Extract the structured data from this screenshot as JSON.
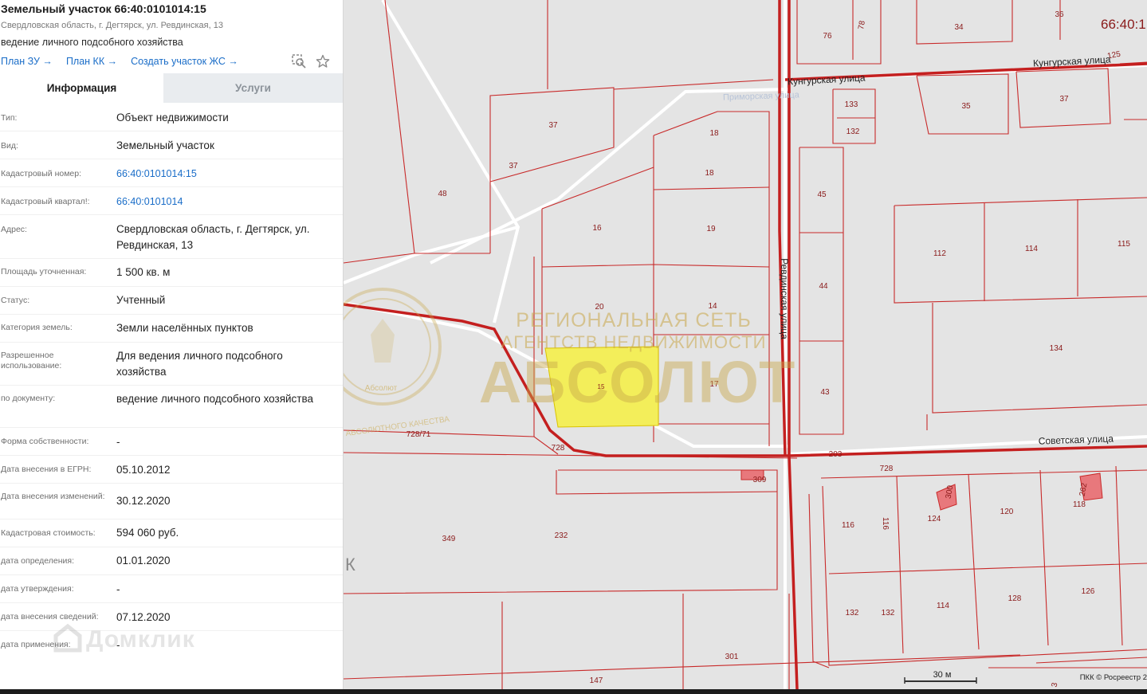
{
  "panel": {
    "title": "Земельный участок 66:40:0101014:15",
    "address_line": "Свердловская область, г. Дегтярск, ул. Ревдинская, 13",
    "usage_line": "ведение личного подсобного хозяйства",
    "links": [
      "План ЗУ →",
      "План КК →",
      "Создать участок ЖС →"
    ],
    "icons": [
      "search-map-icon",
      "star-icon"
    ],
    "tabs": {
      "info": "Информация",
      "services": "Услуги"
    },
    "rows": [
      {
        "label": "Тип:",
        "value": "Объект недвижимости"
      },
      {
        "label": "Вид:",
        "value": "Земельный участок"
      },
      {
        "label": "Кадастровый номер:",
        "value": "66:40:0101014:15"
      },
      {
        "label": "Кадастровый квартал!:",
        "value": "66:40:0101014"
      },
      {
        "label": "Адрес:",
        "value": "Свердловская область, г. Дегтярск, ул. Ревдинская, 13"
      },
      {
        "label": "Площадь уточненная:",
        "value": "1 500 кв. м"
      },
      {
        "label": "Статус:",
        "value": "Учтенный"
      },
      {
        "label": "Категория земель:",
        "value": "Земли населённых пунктов"
      },
      {
        "label": "Разрешенное использование:",
        "value": "Для ведения личного подсобного хозяйства"
      },
      {
        "label": "по документу:",
        "value": "ведение личного подсобного хозяйства"
      },
      {
        "label": "Форма собственности:",
        "value": "-"
      },
      {
        "label": "Дата внесения в ЕГРН:",
        "value": "05.10.2012"
      },
      {
        "label": "Дата внесения изменений:",
        "value": "30.12.2020"
      },
      {
        "label": "Кадастровая стоимость:",
        "value": "594 060 руб."
      },
      {
        "label": "дата определения:",
        "value": "01.01.2020"
      },
      {
        "label": "дата утверждения:",
        "value": "-"
      },
      {
        "label": "дата внесения сведений:",
        "value": "07.12.2020"
      },
      {
        "label": "дата применения:",
        "value": "-"
      }
    ],
    "watermark": "Домклик"
  },
  "map": {
    "quarter_label": "66:40:1",
    "streets": {
      "kungurskaya": "Кунгурская улица",
      "revdinskaya": "Ревдинская улица",
      "sovetskaya": "Советская улица",
      "primorskaya": "Приморская улица"
    },
    "parcels": [
      "76",
      "78",
      "34",
      "36",
      "37",
      "37",
      "48",
      "18",
      "18",
      "16",
      "19",
      "20",
      "14",
      "15",
      "17",
      "133",
      "132",
      "35",
      "37",
      "45",
      "44",
      "43",
      "112",
      "114",
      "115",
      "134",
      "728/71",
      "728",
      "203",
      "728",
      "309",
      "349",
      "232",
      "116",
      "116",
      "124",
      "300",
      "120",
      "118",
      "262",
      "132",
      "132",
      "114",
      "128",
      "126",
      "301",
      "147",
      "125",
      "3"
    ],
    "watermark": {
      "line1": "РЕГИОНАЛЬНАЯ СЕТЬ",
      "line2": "АГЕНТСТВ НЕДВИЖИМОСТИ",
      "brand": "АБСОЛЮТ",
      "emblem_text": "Абсолют",
      "slogan": "ЗНАК АБСОЛЮТНОГО КАЧЕСТВА"
    },
    "scale_label": "30 м",
    "attribution": "ПКК © Росреестр 2",
    "side_glyph": "К",
    "colors": {
      "boundary": "#cc1f1f",
      "selected_parcel": "#f3ee5a",
      "background": "#e4e4e4",
      "building": "#e8787c"
    }
  }
}
